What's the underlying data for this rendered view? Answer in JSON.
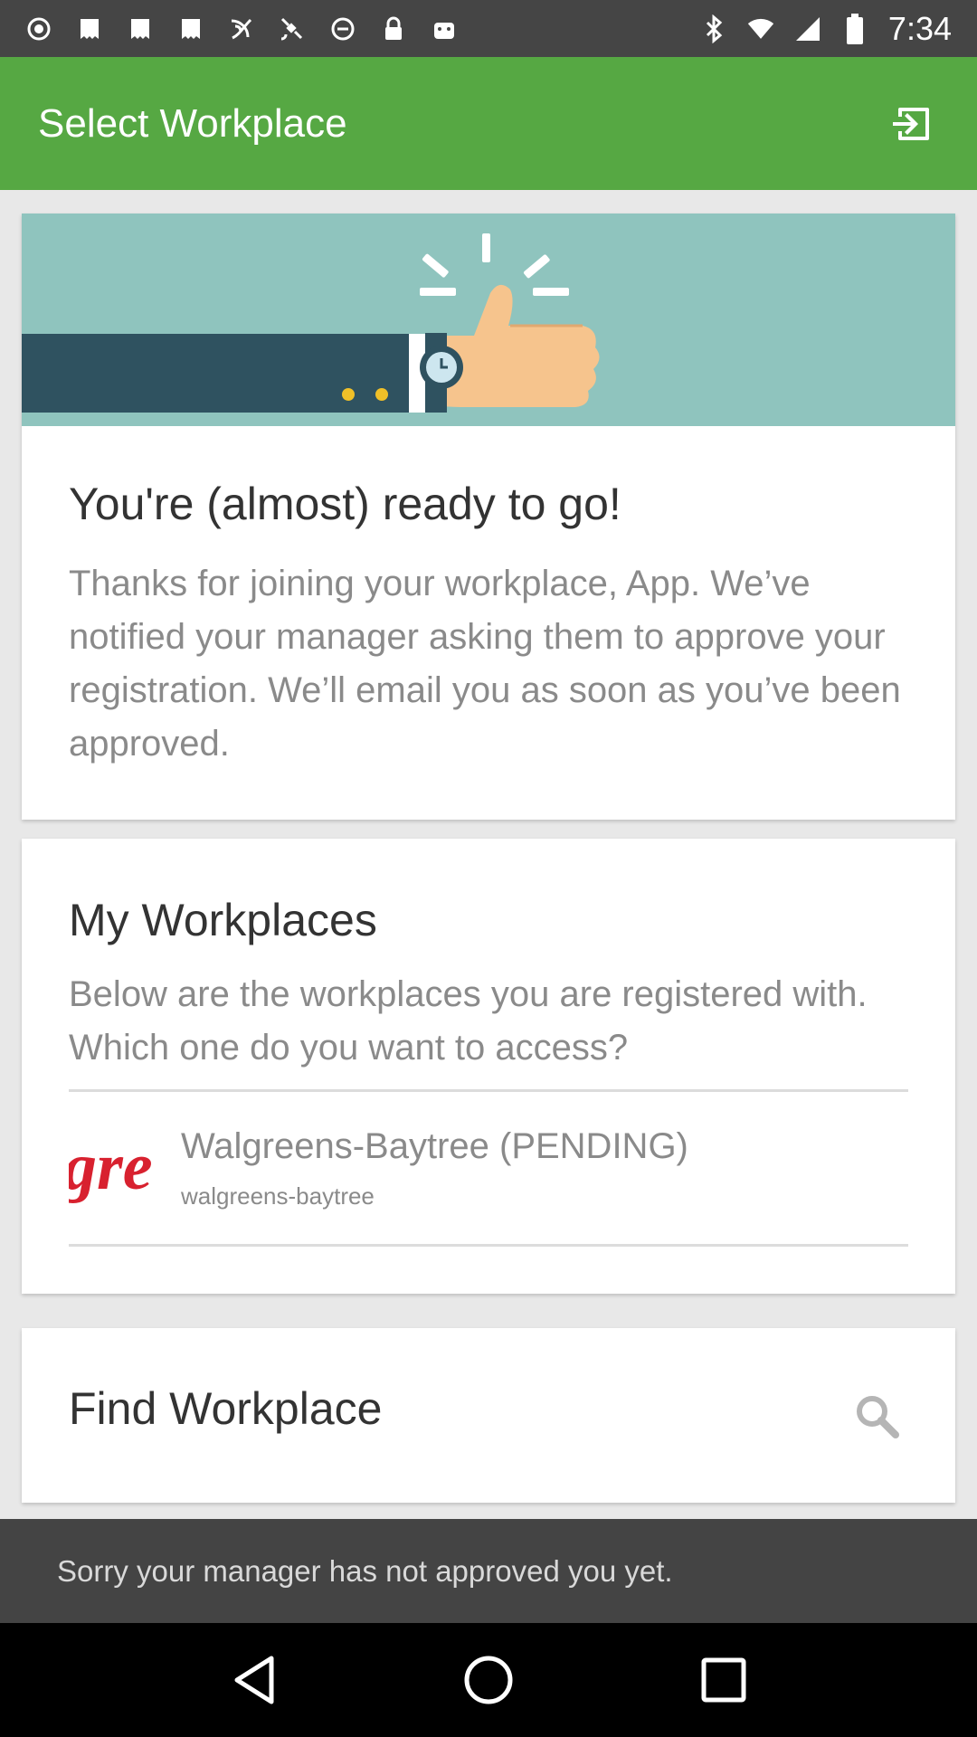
{
  "status_bar": {
    "time": "7:34",
    "left_icons": [
      "record-icon",
      "news-icon",
      "news-icon",
      "news-icon",
      "broadcast-icon",
      "satellite-icon",
      "dnd-icon",
      "lock-icon",
      "android-icon"
    ],
    "right_icons": [
      "bluetooth-icon",
      "wifi-icon",
      "signal-icon",
      "battery-icon"
    ]
  },
  "app_bar": {
    "title": "Select Workplace",
    "action_icon": "exit-icon",
    "background": "#56a843"
  },
  "ready_card": {
    "title": "You're (almost) ready to go!",
    "body": "Thanks for joining your workplace, App. We’ve notified your manager asking them to approve your registration. We’ll email you as soon as you’ve been approved."
  },
  "workplaces_card": {
    "title": "My Workplaces",
    "body": "Below are the workplaces you are registered with. Which one do you want to access?",
    "items": [
      {
        "name": "Walgreens-Baytree (PENDING)",
        "slug": "walgreens-baytree",
        "logo_text": "gre"
      }
    ]
  },
  "find_card": {
    "title": "Find Workplace",
    "icon": "search-icon"
  },
  "snackbar": {
    "message": "Sorry your manager has not approved you yet."
  },
  "nav": {
    "back": "back-icon",
    "home": "home-icon",
    "recents": "recents-icon"
  }
}
